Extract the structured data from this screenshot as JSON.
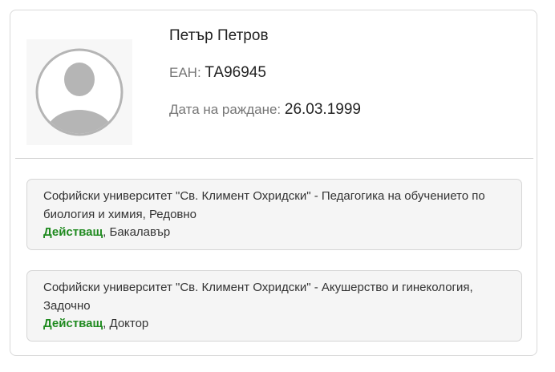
{
  "profile": {
    "name": "Петър Петров",
    "ean_label": "ЕАН:",
    "ean_value": "ТА96945",
    "birth_label": "Дата на раждане:",
    "birth_value": "26.03.1999",
    "avatar_icon": "user-placeholder-icon"
  },
  "education": [
    {
      "description": "Софийски университет \"Св. Климент Охридски\" - Педагогика на обучението по биология и химия, Редовно",
      "status": "Действащ",
      "degree": ", Бакалавър"
    },
    {
      "description": "Софийски университет \"Св. Климент Охридски\" - Акушерство и гинекология, Задочно",
      "status": "Действащ",
      "degree": ", Доктор"
    }
  ],
  "colors": {
    "status_active": "#1f8a1f",
    "card_border": "#d9d9d9",
    "item_background": "#f5f5f5"
  }
}
